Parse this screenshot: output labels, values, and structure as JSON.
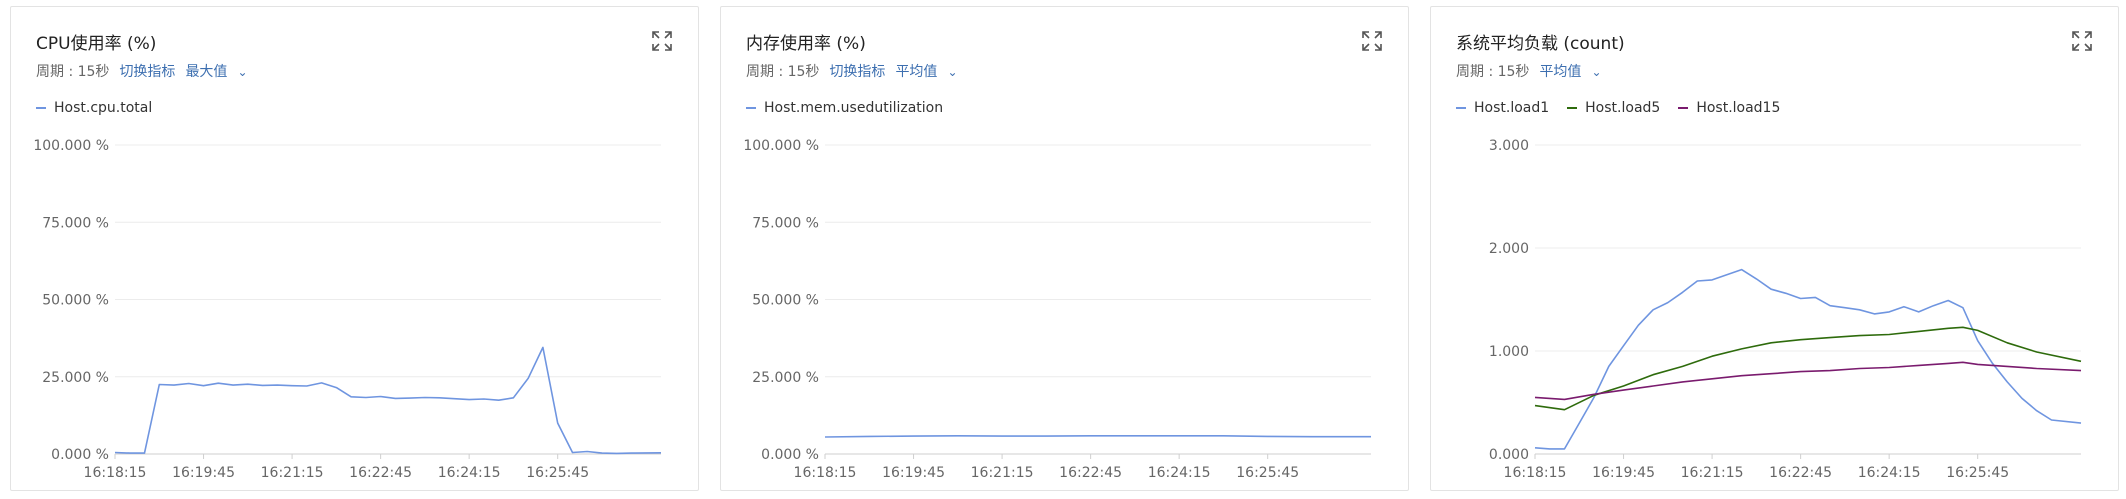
{
  "panels": [
    {
      "title": "CPU使用率 (%)",
      "period": "周期 : 15秒",
      "switch_label": "切换指标",
      "agg_label": "最大值"
    },
    {
      "title": "内存使用率 (%)",
      "period": "周期 : 15秒",
      "switch_label": "切换指标",
      "agg_label": "平均值"
    },
    {
      "title": "系统平均负载 (count)",
      "period": "周期 : 15秒",
      "agg_label": "平均值"
    }
  ],
  "icons": {
    "expand": "expand-icon",
    "dropdown": "chevron-down-icon"
  },
  "chart_data": [
    {
      "type": "line",
      "title": "CPU使用率 (%)",
      "x_ticks": [
        "16:18:15",
        "16:19:45",
        "16:21:15",
        "16:22:45",
        "16:24:15",
        "16:25:45"
      ],
      "y_ticks": [
        "0.000 %",
        "25.000 %",
        "50.000 %",
        "75.000 %",
        "100.000 %"
      ],
      "ylim": [
        0,
        100
      ],
      "xlim": [
        "16:18:15",
        "16:27:30"
      ],
      "grid": true,
      "legend_position": "top-left",
      "series": [
        {
          "name": "Host.cpu.total",
          "color": "#6f95e0",
          "x": [
            "16:18:15",
            "16:18:30",
            "16:18:45",
            "16:19:00",
            "16:19:15",
            "16:19:30",
            "16:19:45",
            "16:20:00",
            "16:20:15",
            "16:20:30",
            "16:20:45",
            "16:21:00",
            "16:21:15",
            "16:21:30",
            "16:21:45",
            "16:22:00",
            "16:22:15",
            "16:22:30",
            "16:22:45",
            "16:23:00",
            "16:23:15",
            "16:23:30",
            "16:23:45",
            "16:24:00",
            "16:24:15",
            "16:24:30",
            "16:24:45",
            "16:25:00",
            "16:25:15",
            "16:25:30",
            "16:25:45",
            "16:26:00",
            "16:26:15",
            "16:26:30",
            "16:26:45",
            "16:27:00",
            "16:27:30"
          ],
          "values": [
            0.5,
            0.3,
            0.3,
            22.5,
            22.3,
            22.8,
            22.1,
            22.9,
            22.3,
            22.6,
            22.2,
            22.3,
            22.1,
            22.0,
            23.0,
            21.5,
            18.5,
            18.3,
            18.6,
            18.0,
            18.1,
            18.3,
            18.2,
            17.9,
            17.6,
            17.8,
            17.4,
            18.2,
            24.5,
            34.5,
            10.0,
            0.5,
            0.8,
            0.3,
            0.2,
            0.3,
            0.4
          ]
        }
      ]
    },
    {
      "type": "line",
      "title": "内存使用率 (%)",
      "x_ticks": [
        "16:18:15",
        "16:19:45",
        "16:21:15",
        "16:22:45",
        "16:24:15",
        "16:25:45"
      ],
      "y_ticks": [
        "0.000 %",
        "25.000 %",
        "50.000 %",
        "75.000 %",
        "100.000 %"
      ],
      "ylim": [
        0,
        100
      ],
      "xlim": [
        "16:18:15",
        "16:27:30"
      ],
      "grid": true,
      "legend_position": "top-left",
      "series": [
        {
          "name": "Host.mem.usedutilization",
          "color": "#6f95e0",
          "x": [
            "16:18:15",
            "16:19:00",
            "16:19:45",
            "16:20:30",
            "16:21:15",
            "16:22:00",
            "16:22:45",
            "16:23:30",
            "16:24:15",
            "16:25:00",
            "16:25:45",
            "16:26:30",
            "16:27:30"
          ],
          "values": [
            5.5,
            5.7,
            5.8,
            5.9,
            5.8,
            5.8,
            5.9,
            5.9,
            5.9,
            5.9,
            5.7,
            5.6,
            5.6
          ]
        }
      ]
    },
    {
      "type": "line",
      "title": "系统平均负载 (count)",
      "x_ticks": [
        "16:18:15",
        "16:19:45",
        "16:21:15",
        "16:22:45",
        "16:24:15",
        "16:25:45"
      ],
      "y_ticks": [
        "0.000",
        "1.000",
        "2.000",
        "3.000"
      ],
      "ylim": [
        0,
        3
      ],
      "xlim": [
        "16:18:15",
        "16:27:30"
      ],
      "grid": true,
      "legend_position": "top-left",
      "series": [
        {
          "name": "Host.load1",
          "color": "#6f95e0",
          "x": [
            "16:18:15",
            "16:18:30",
            "16:18:45",
            "16:19:00",
            "16:19:15",
            "16:19:30",
            "16:19:45",
            "16:20:00",
            "16:20:15",
            "16:20:30",
            "16:20:45",
            "16:21:00",
            "16:21:15",
            "16:21:30",
            "16:21:45",
            "16:22:00",
            "16:22:15",
            "16:22:30",
            "16:22:45",
            "16:23:00",
            "16:23:15",
            "16:23:30",
            "16:23:45",
            "16:24:00",
            "16:24:15",
            "16:24:30",
            "16:24:45",
            "16:25:00",
            "16:25:15",
            "16:25:30",
            "16:25:45",
            "16:26:00",
            "16:26:15",
            "16:26:30",
            "16:26:45",
            "16:27:00",
            "16:27:30"
          ],
          "values": [
            0.06,
            0.05,
            0.05,
            0.3,
            0.55,
            0.85,
            1.05,
            1.25,
            1.4,
            1.47,
            1.57,
            1.68,
            1.69,
            1.74,
            1.79,
            1.7,
            1.6,
            1.56,
            1.51,
            1.52,
            1.44,
            1.42,
            1.4,
            1.36,
            1.38,
            1.43,
            1.38,
            1.44,
            1.49,
            1.42,
            1.1,
            0.88,
            0.7,
            0.54,
            0.42,
            0.33,
            0.3
          ]
        },
        {
          "name": "Host.load5",
          "color": "#2e6b0c",
          "x": [
            "16:18:15",
            "16:18:45",
            "16:19:15",
            "16:19:45",
            "16:20:15",
            "16:20:45",
            "16:21:15",
            "16:21:45",
            "16:22:15",
            "16:22:45",
            "16:23:15",
            "16:23:45",
            "16:24:15",
            "16:24:45",
            "16:25:15",
            "16:25:30",
            "16:25:45",
            "16:26:15",
            "16:26:45",
            "16:27:30"
          ],
          "values": [
            0.47,
            0.43,
            0.57,
            0.66,
            0.77,
            0.85,
            0.95,
            1.02,
            1.08,
            1.11,
            1.13,
            1.15,
            1.16,
            1.19,
            1.22,
            1.23,
            1.2,
            1.08,
            0.99,
            0.9
          ]
        },
        {
          "name": "Host.load15",
          "color": "#7a1b6e",
          "x": [
            "16:18:15",
            "16:18:45",
            "16:19:15",
            "16:19:45",
            "16:20:15",
            "16:20:45",
            "16:21:15",
            "16:21:45",
            "16:22:15",
            "16:22:45",
            "16:23:15",
            "16:23:45",
            "16:24:15",
            "16:24:45",
            "16:25:15",
            "16:25:30",
            "16:25:45",
            "16:26:15",
            "16:26:45",
            "16:27:30"
          ],
          "values": [
            0.55,
            0.53,
            0.58,
            0.62,
            0.66,
            0.7,
            0.73,
            0.76,
            0.78,
            0.8,
            0.81,
            0.83,
            0.84,
            0.86,
            0.88,
            0.89,
            0.87,
            0.85,
            0.83,
            0.81
          ]
        }
      ]
    }
  ]
}
